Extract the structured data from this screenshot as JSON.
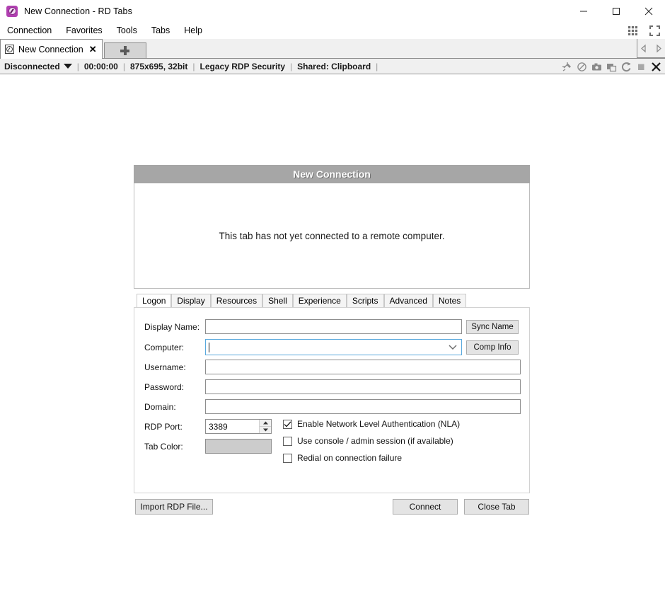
{
  "window": {
    "title": "New Connection - RD Tabs",
    "app_icon": "rdtabs-logo-icon",
    "minimize_label": "Minimize",
    "maximize_label": "Maximize",
    "close_label": "Close"
  },
  "menubar": {
    "items": [
      {
        "label": "Connection"
      },
      {
        "label": "Favorites"
      },
      {
        "label": "Tools"
      },
      {
        "label": "Tabs"
      },
      {
        "label": "Help"
      }
    ],
    "right_icons": [
      {
        "name": "tile-grid-icon"
      },
      {
        "name": "fullscreen-icon"
      }
    ]
  },
  "tabstrip": {
    "tabs": [
      {
        "label": "New Connection",
        "icon": "connection-icon",
        "close": "✕",
        "active": true
      }
    ],
    "new_tab_label": "New Tab",
    "nav_prev": "Previous Tab",
    "nav_next": "Next Tab"
  },
  "statusbar": {
    "connection_state": "Disconnected",
    "duration": "00:00:00",
    "resolution": "875x695, 32bit",
    "security": "Legacy RDP Security",
    "shared": "Shared: Clipboard",
    "separator": "|",
    "icons": [
      {
        "name": "pin-tack-icon"
      },
      {
        "name": "disconnect-icon"
      },
      {
        "name": "screenshot-camera-icon"
      },
      {
        "name": "duplicate-tab-icon"
      },
      {
        "name": "reconnect-refresh-icon"
      },
      {
        "name": "stop-square-icon"
      },
      {
        "name": "close-x-icon"
      }
    ]
  },
  "connection_panel": {
    "header_title": "New Connection",
    "message": "This tab has not yet connected to a remote computer."
  },
  "form": {
    "tabs": [
      {
        "label": "Logon",
        "active": true
      },
      {
        "label": "Display",
        "active": false
      },
      {
        "label": "Resources",
        "active": false
      },
      {
        "label": "Shell",
        "active": false
      },
      {
        "label": "Experience",
        "active": false
      },
      {
        "label": "Scripts",
        "active": false
      },
      {
        "label": "Advanced",
        "active": false
      },
      {
        "label": "Notes",
        "active": false
      }
    ],
    "fields": {
      "display_name_label": "Display Name:",
      "display_name_value": "",
      "sync_name_button": "Sync Name",
      "computer_label": "Computer:",
      "computer_value": "",
      "comp_info_button": "Comp Info",
      "username_label": "Username:",
      "username_value": "",
      "password_label": "Password:",
      "password_value": "",
      "domain_label": "Domain:",
      "domain_value": "",
      "rdp_port_label": "RDP Port:",
      "rdp_port_value": "3389",
      "tab_color_label": "Tab Color:",
      "tab_color_value": "#cccccc"
    },
    "checkboxes": [
      {
        "label": "Enable Network Level Authentication (NLA)",
        "checked": true
      },
      {
        "label": "Use console / admin session (if available)",
        "checked": false
      },
      {
        "label": "Redial on connection failure",
        "checked": false
      }
    ]
  },
  "actions": {
    "import_rdp": "Import RDP File...",
    "connect": "Connect",
    "close_tab": "Close Tab"
  },
  "colors": {
    "accent": "#b13fb1",
    "panel_header": "#a6a6a6",
    "focus_border": "#5aa9dd",
    "chrome": "#f0f0f0"
  }
}
